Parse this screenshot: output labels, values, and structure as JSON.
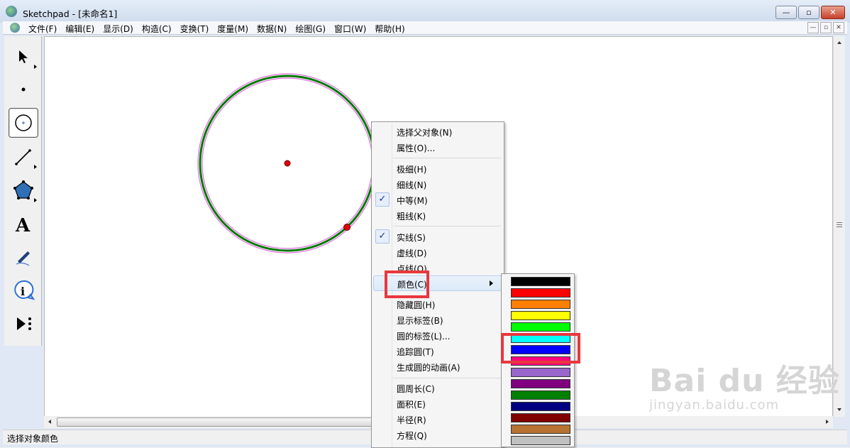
{
  "window": {
    "title": "Sketchpad  - [未命名1]"
  },
  "menubar": {
    "items": [
      "文件(F)",
      "编辑(E)",
      "显示(D)",
      "构造(C)",
      "变换(T)",
      "度量(M)",
      "数据(N)",
      "绘图(G)",
      "窗口(W)",
      "帮助(H)"
    ]
  },
  "toolbox": {
    "tools": [
      "selection-arrow-tool",
      "point-tool",
      "compass-tool",
      "straightedge-tool",
      "polygon-tool",
      "text-tool",
      "marker-tool",
      "information-tool",
      "custom-tool"
    ],
    "active": "compass-tool"
  },
  "context_menu": {
    "items": [
      "选择父对象(N)",
      "属性(O)...",
      "极细(H)",
      "细线(N)",
      "中等(M)",
      "粗线(K)",
      "实线(S)",
      "虚线(D)",
      "点线(O)",
      "颜色(C)",
      "隐藏圆(H)",
      "显示标签(B)",
      "圆的标签(L)...",
      "追踪圆(T)",
      "生成圆的动画(A)",
      "圆周长(C)",
      "面积(E)",
      "半径(R)",
      "方程(Q)"
    ],
    "checked": [
      "中等(M)",
      "实线(S)"
    ],
    "highlighted": "颜色(C)"
  },
  "color_palette": {
    "colors": [
      "#000000",
      "#ff0000",
      "#ff8000",
      "#ffff00",
      "#00ff00",
      "#00ffff",
      "#0000ff",
      "#ff0080",
      "#9966cc",
      "#800080",
      "#008000",
      "#000080",
      "#800000",
      "#b87333",
      "#c0c0c0"
    ],
    "selected_color": "#0000ff"
  },
  "statusbar": {
    "text": "选择对象颜色"
  },
  "watermark": {
    "main": "Bai du 经验",
    "sub": "jingyan.baidu.com"
  }
}
